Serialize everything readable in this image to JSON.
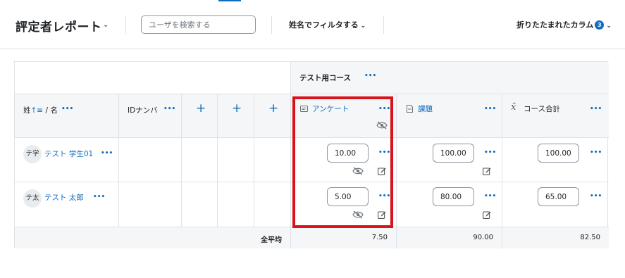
{
  "header": {
    "title": "評定者レポート",
    "search_placeholder": "ユーザを検索する",
    "filter_label": "姓名でフィルタする",
    "collapsed_label": "折りたたまれたカラム",
    "collapsed_count": "3"
  },
  "table": {
    "course_header": "テスト用コース",
    "name_col_label": "姓",
    "name_col_label2": "/ 名",
    "id_col_label": "IDナンバ",
    "columns": [
      {
        "label": "アンケート",
        "icon": "quiz-icon"
      },
      {
        "label": "課題",
        "icon": "assignment-icon"
      },
      {
        "label": "コース合計",
        "icon": "sigma-icon"
      }
    ],
    "rows": [
      {
        "initials": "テ学",
        "name": "テスト 学生01",
        "grades": [
          "10.00",
          "100.00",
          "100.00"
        ]
      },
      {
        "initials": "テ太",
        "name": "テスト 太郎",
        "grades": [
          "5.00",
          "80.00",
          "65.00"
        ]
      }
    ],
    "average_label": "全平均",
    "averages": [
      "7.50",
      "90.00",
      "82.50"
    ]
  },
  "colors": {
    "accent": "#0f6cbf",
    "highlight": "#d9131c"
  }
}
